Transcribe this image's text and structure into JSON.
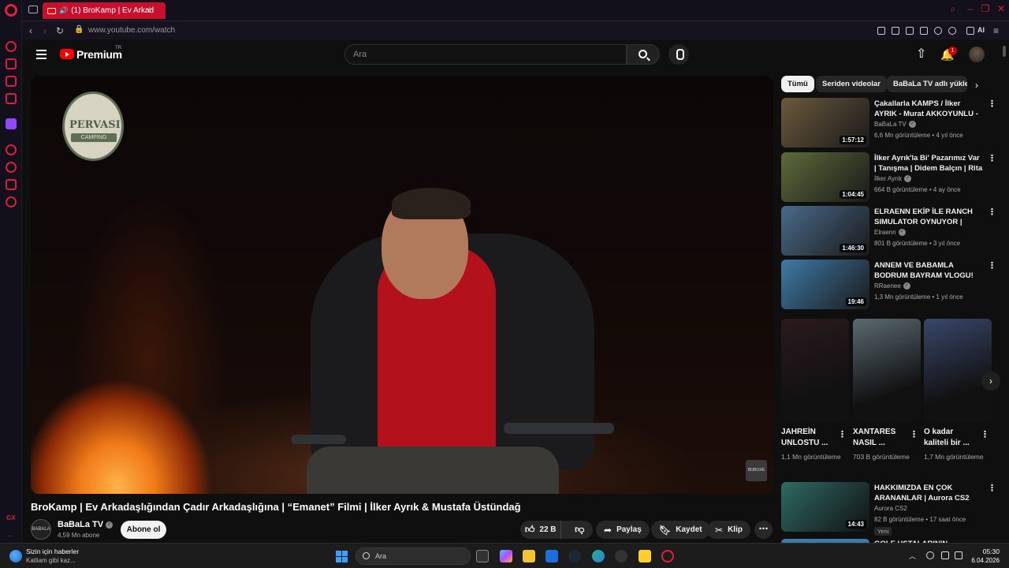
{
  "browser": {
    "tab_title": "(1) BroKamp | Ev Arkad",
    "new_tab": "+",
    "url": "www.youtube.com/watch",
    "ai_label": "AI",
    "gx_label": "GX",
    "more_label": "..."
  },
  "youtube": {
    "brand": "Premium",
    "region": "TR",
    "search_placeholder": "Ara",
    "notification_count": "1"
  },
  "video": {
    "title": "BroKamp | Ev Arkadaşlığından Çadır Arkadaşlığına | “Emanet” Filmi | İlker Ayrık & Mustafa Üstündağ",
    "logo_text": "PERVASI",
    "logo_sub": "CAMPING",
    "watermark": "BOBOXE",
    "channel": {
      "name": "BaBaLa TV",
      "avatar_text": "BABALA",
      "subscribers": "4,59 Mn abone",
      "subscribe_label": "Abone ol"
    },
    "actions": {
      "likes": "22 B",
      "share": "Paylaş",
      "save": "Kaydet",
      "clip": "Klip",
      "more": "⋯"
    }
  },
  "chips": [
    {
      "label": "Tümü",
      "active": true
    },
    {
      "label": "Seriden videolar",
      "active": false
    },
    {
      "label": "BaBaLa TV adlı yükleyiciden",
      "active": false
    }
  ],
  "recommendations": [
    {
      "title": "Çakallarla KAMPS / İlker AYRIK - Murat AKKOYUNLU - Timur ...",
      "channel": "BaBaLa TV",
      "meta": "6,6 Mn görüntüleme • 4 yıl önce",
      "duration": "1:57:12",
      "thumb_color": "#6b5a3c"
    },
    {
      "title": "İlker Ayrık'la Bi' Pazarımız Var | Tanışma | Didem Balçın | Rita ...",
      "channel": "İlker Ayrık",
      "meta": "664 B görüntüleme • 4 ay önce",
      "duration": "1:04:45",
      "thumb_color": "#5d6a3a"
    },
    {
      "title": "ELRAENN EKİP İLE RANCH SIMULATOR OYNUYOR | TEMİ...",
      "channel": "Elraenn",
      "meta": "801 B görüntüleme • 3 yıl önce",
      "duration": "1:46:30",
      "thumb_color": "#4a6a8a"
    },
    {
      "title": "ANNEM VE BABAMLA BODRUM BAYRAM VLOGU!",
      "channel": "RRaenee",
      "meta": "1,3 Mn görüntüleme • 1 yıl önce",
      "duration": "19:46",
      "thumb_color": "#3e7aa8"
    }
  ],
  "shorts": [
    {
      "title": "JAHREİN UNLOSTU ...",
      "views": "1,1 Mn görüntüleme",
      "thumb_color": "#2a1a1e"
    },
    {
      "title": "XANTARES NASIL ...",
      "views": "703 B görüntüleme",
      "thumb_color": "#5a6a72"
    },
    {
      "title": "O kadar kaliteli bir ...",
      "views": "1,7 Mn görüntüleme",
      "thumb_color": "#39476a"
    }
  ],
  "rec_bottom": {
    "title": "HAKKIMIZDA EN ÇOK ARANANLAR | Aurora CS2",
    "channel": "Aurora CS2",
    "meta": "82 B görüntüleme • 17 saat önce",
    "badge": "Yeni",
    "duration": "14:43",
    "thumb_color": "#2f6a64",
    "next_title": "GOLE USTALARININ..."
  },
  "taskbar": {
    "news_title": "Sizin için haberler",
    "news_sub": "Katliam gibi kaz...",
    "search_label": "Ara",
    "time": "05:30",
    "date": "6.04.2026"
  }
}
